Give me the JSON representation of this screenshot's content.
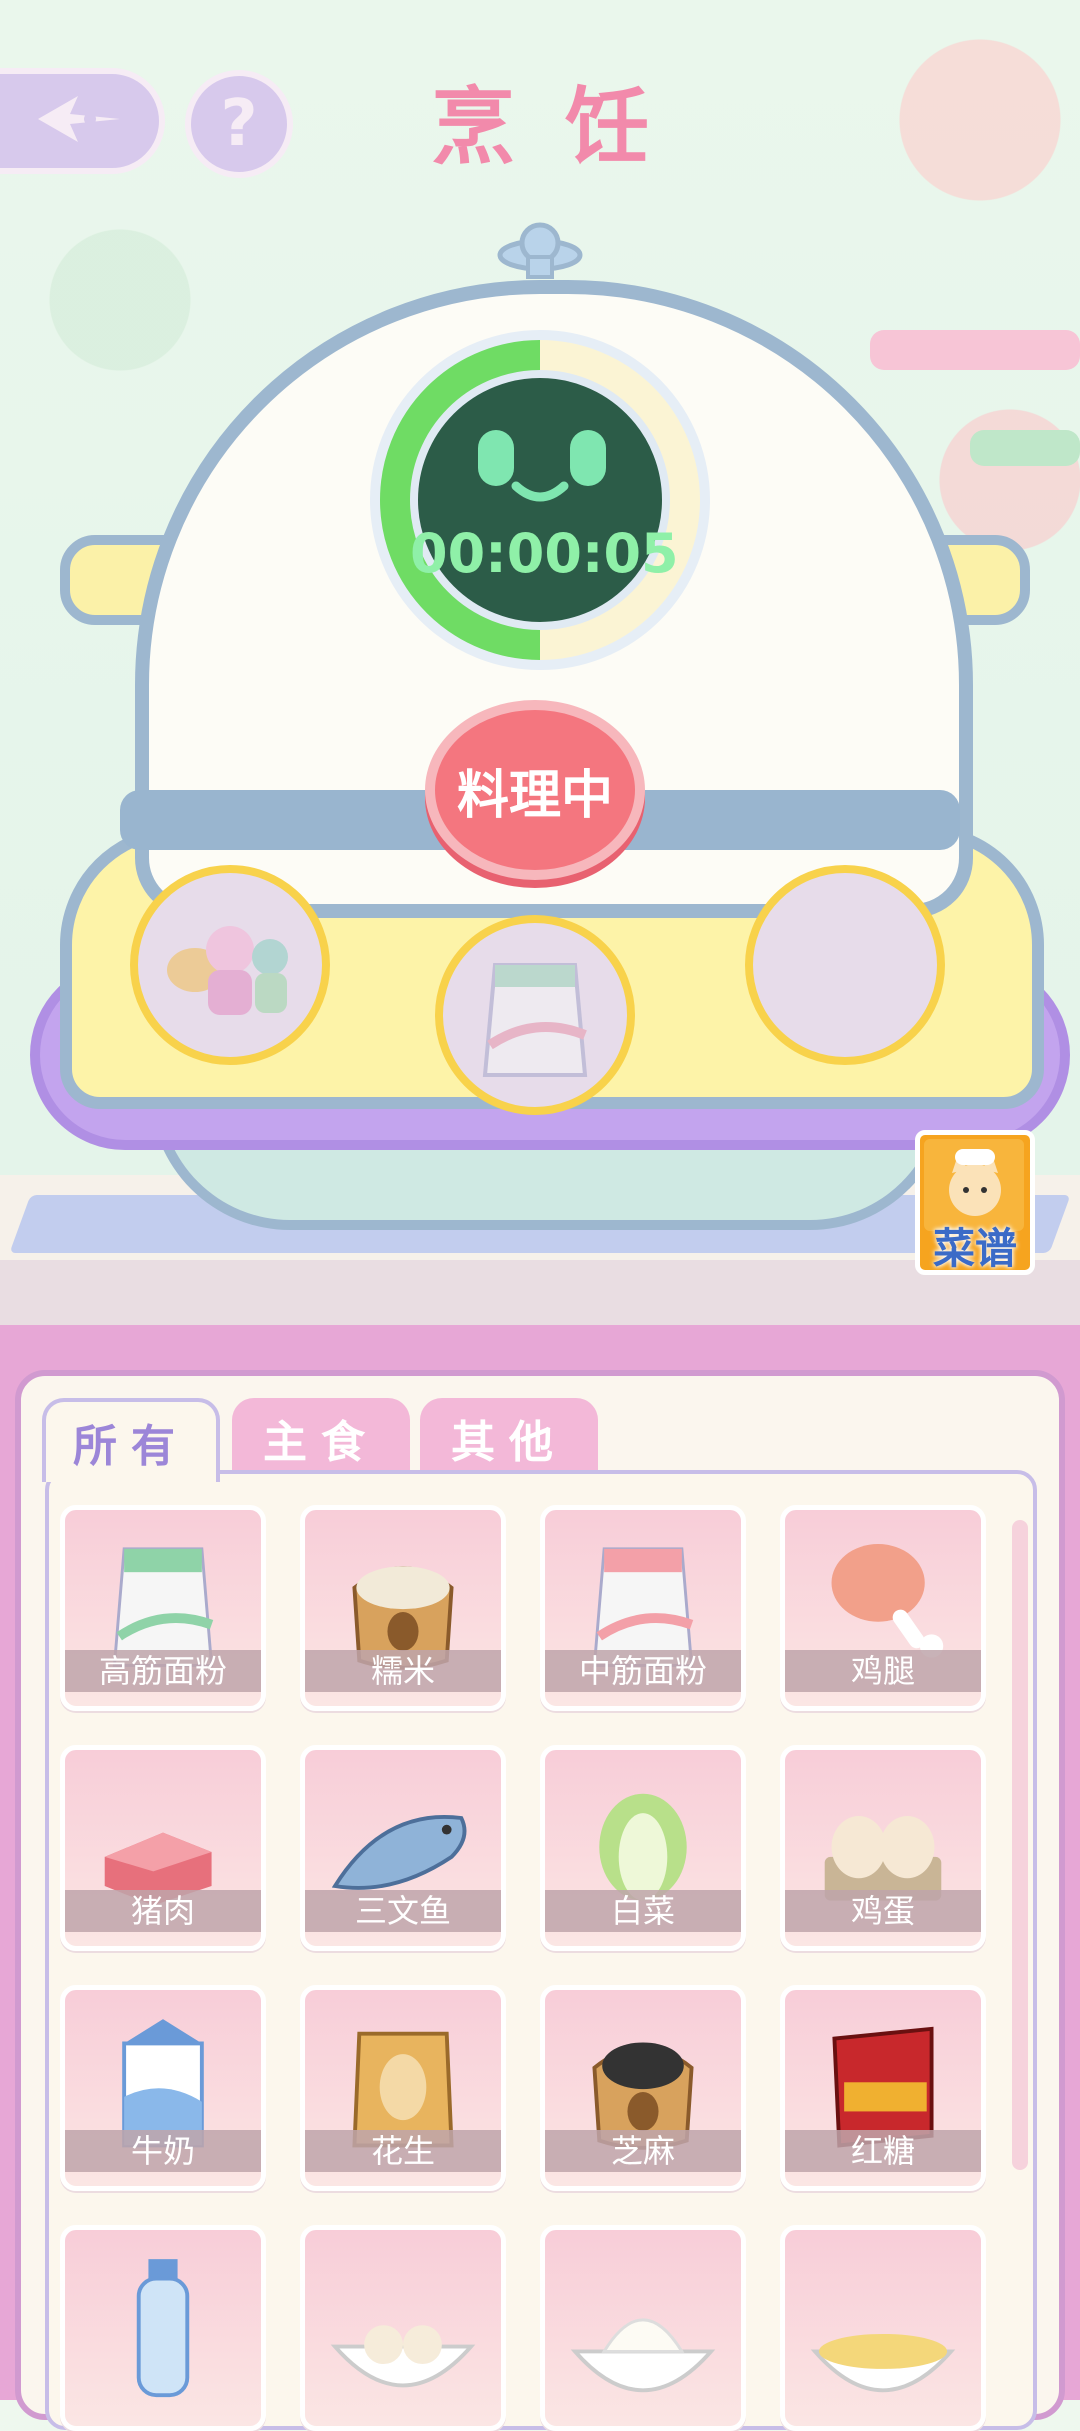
{
  "header": {
    "title": "烹饪",
    "back_icon": "sparkle-arrow-icon",
    "help_icon": "question-icon",
    "help_glyph": "?"
  },
  "cooker": {
    "timer": "00:00:05",
    "progress_fraction": 0.5,
    "status_button": "料理中",
    "slots": [
      {
        "state": "filled",
        "icon": "dolls-icon"
      },
      {
        "state": "filled",
        "icon": "flour-bag-icon"
      },
      {
        "state": "empty"
      }
    ]
  },
  "recipe_button": {
    "label": "菜谱",
    "icon": "cat-chef-book-icon"
  },
  "tabs": [
    {
      "label": "所有",
      "active": true
    },
    {
      "label": "主食",
      "active": false
    },
    {
      "label": "其他",
      "active": false
    }
  ],
  "ingredients": [
    {
      "label": "高筋面粉",
      "icon": "flour-green-icon"
    },
    {
      "label": "糯米",
      "icon": "rice-sack-icon"
    },
    {
      "label": "中筋面粉",
      "icon": "flour-pink-icon"
    },
    {
      "label": "鸡腿",
      "icon": "drumstick-icon"
    },
    {
      "label": "猪肉",
      "icon": "pork-icon"
    },
    {
      "label": "三文鱼",
      "icon": "salmon-icon"
    },
    {
      "label": "白菜",
      "icon": "cabbage-icon"
    },
    {
      "label": "鸡蛋",
      "icon": "eggs-icon"
    },
    {
      "label": "牛奶",
      "icon": "milk-carton-icon"
    },
    {
      "label": "花生",
      "icon": "peanut-bag-icon"
    },
    {
      "label": "芝麻",
      "icon": "sesame-sack-icon"
    },
    {
      "label": "红糖",
      "icon": "brown-sugar-icon"
    },
    {
      "label": "",
      "icon": "water-bottle-icon"
    },
    {
      "label": "",
      "icon": "dumpling-bowl-icon"
    },
    {
      "label": "",
      "icon": "cream-bowl-icon"
    },
    {
      "label": "",
      "icon": "custard-bowl-icon"
    }
  ],
  "colors": {
    "accent": "#f28aab",
    "panel": "#e7a7d6",
    "timer_green": "#6fdc64",
    "cook_button": "#f4767f"
  }
}
